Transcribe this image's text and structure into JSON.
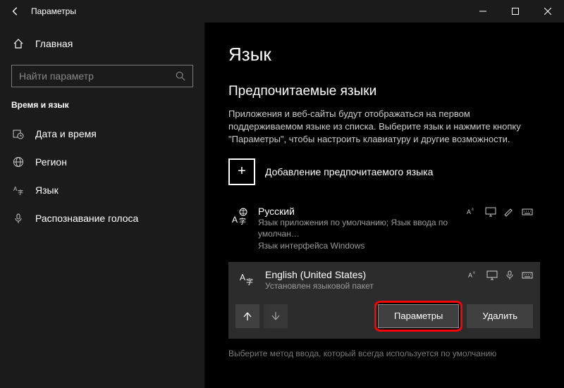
{
  "titlebar": {
    "title": "Параметры"
  },
  "sidebar": {
    "home": "Главная",
    "search_placeholder": "Найти параметр",
    "section": "Время и язык",
    "items": [
      {
        "label": "Дата и время"
      },
      {
        "label": "Регион"
      },
      {
        "label": "Язык"
      },
      {
        "label": "Распознавание голоса"
      }
    ]
  },
  "content": {
    "page_title": "Язык",
    "subtitle": "Предпочитаемые языки",
    "description": "Приложения и веб-сайты будут отображаться на первом поддерживаемом языке из списка. Выберите язык и нажмите кнопку \"Параметры\", чтобы настроить клавиатуру и другие возможности.",
    "add_label": "Добавление предпочитаемого языка",
    "languages": [
      {
        "name": "Русский",
        "sub": "Язык приложения по умолчанию; Язык ввода по умолчан…\nЯзык интерфейса Windows"
      },
      {
        "name": "English (United States)",
        "sub": "Установлен языковой пакет"
      }
    ],
    "buttons": {
      "options": "Параметры",
      "delete": "Удалить"
    },
    "hint": "Выберите метод ввода, который всегда используется по умолчанию"
  }
}
